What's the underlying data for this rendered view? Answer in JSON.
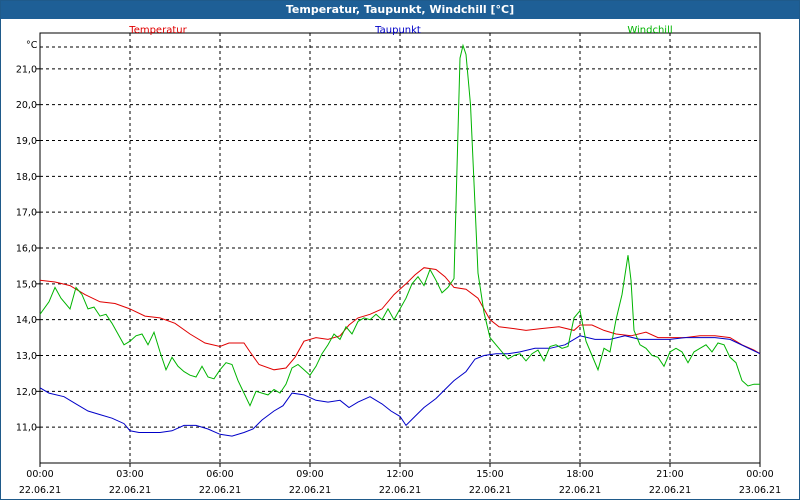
{
  "window": {
    "title": "Temperatur, Taupunkt, Windchill [°C]"
  },
  "chart_data": {
    "type": "line",
    "title": "Temperatur, Taupunkt, Windchill [°C]",
    "ylabel": "°C",
    "ylim": [
      10.0,
      22.0
    ],
    "y_ticks": [
      "11,0",
      "12,0",
      "13,0",
      "14,0",
      "15,0",
      "16,0",
      "17,0",
      "18,0",
      "19,0",
      "20,0",
      "21,0"
    ],
    "y_tick_values": [
      11,
      12,
      13,
      14,
      15,
      16,
      17,
      18,
      19,
      20,
      21
    ],
    "xlim": [
      0,
      24
    ],
    "x_ticks": [
      {
        "time": "00:00",
        "date": "22.06.21",
        "hour": 0
      },
      {
        "time": "03:00",
        "date": "22.06.21",
        "hour": 3
      },
      {
        "time": "06:00",
        "date": "22.06.21",
        "hour": 6
      },
      {
        "time": "09:00",
        "date": "22.06.21",
        "hour": 9
      },
      {
        "time": "12:00",
        "date": "22.06.21",
        "hour": 12
      },
      {
        "time": "15:00",
        "date": "22.06.21",
        "hour": 15
      },
      {
        "time": "18:00",
        "date": "22.06.21",
        "hour": 18
      },
      {
        "time": "21:00",
        "date": "22.06.21",
        "hour": 21
      },
      {
        "time": "00:00",
        "date": "23.06.21",
        "hour": 24
      }
    ],
    "grid": true,
    "legend_position": "top",
    "series": [
      {
        "name": "Temperatur",
        "color": "#e00000",
        "points": [
          [
            0,
            15.1
          ],
          [
            0.5,
            15.05
          ],
          [
            1,
            14.95
          ],
          [
            1.5,
            14.7
          ],
          [
            2,
            14.5
          ],
          [
            2.5,
            14.45
          ],
          [
            3,
            14.3
          ],
          [
            3.5,
            14.1
          ],
          [
            4,
            14.05
          ],
          [
            4.5,
            13.9
          ],
          [
            5,
            13.6
          ],
          [
            5.5,
            13.35
          ],
          [
            6,
            13.25
          ],
          [
            6.3,
            13.35
          ],
          [
            6.8,
            13.35
          ],
          [
            7,
            13.1
          ],
          [
            7.3,
            12.75
          ],
          [
            7.8,
            12.6
          ],
          [
            8.2,
            12.65
          ],
          [
            8.5,
            12.95
          ],
          [
            8.8,
            13.4
          ],
          [
            9.2,
            13.5
          ],
          [
            9.6,
            13.45
          ],
          [
            10,
            13.55
          ],
          [
            10.3,
            13.85
          ],
          [
            10.6,
            14.05
          ],
          [
            11,
            14.15
          ],
          [
            11.4,
            14.3
          ],
          [
            11.8,
            14.7
          ],
          [
            12.2,
            15.0
          ],
          [
            12.5,
            15.25
          ],
          [
            12.8,
            15.45
          ],
          [
            13.2,
            15.4
          ],
          [
            13.5,
            15.2
          ],
          [
            13.8,
            14.9
          ],
          [
            14.2,
            14.85
          ],
          [
            14.6,
            14.6
          ],
          [
            15,
            14.0
          ],
          [
            15.3,
            13.8
          ],
          [
            15.8,
            13.75
          ],
          [
            16.2,
            13.7
          ],
          [
            16.7,
            13.75
          ],
          [
            17.3,
            13.8
          ],
          [
            17.8,
            13.7
          ],
          [
            18,
            13.85
          ],
          [
            18.4,
            13.85
          ],
          [
            18.8,
            13.7
          ],
          [
            19.2,
            13.6
          ],
          [
            19.7,
            13.55
          ],
          [
            20.2,
            13.65
          ],
          [
            20.6,
            13.5
          ],
          [
            21,
            13.5
          ],
          [
            21.5,
            13.5
          ],
          [
            22,
            13.55
          ],
          [
            22.5,
            13.55
          ],
          [
            23,
            13.5
          ],
          [
            23.4,
            13.3
          ],
          [
            23.8,
            13.15
          ],
          [
            24,
            13.05
          ]
        ]
      },
      {
        "name": "Taupunkt",
        "color": "#0000c8",
        "points": [
          [
            0,
            12.1
          ],
          [
            0.3,
            11.95
          ],
          [
            0.8,
            11.85
          ],
          [
            1.2,
            11.65
          ],
          [
            1.6,
            11.45
          ],
          [
            2,
            11.35
          ],
          [
            2.4,
            11.25
          ],
          [
            2.8,
            11.1
          ],
          [
            3,
            10.9
          ],
          [
            3.3,
            10.85
          ],
          [
            3.6,
            10.85
          ],
          [
            4,
            10.85
          ],
          [
            4.4,
            10.9
          ],
          [
            4.8,
            11.05
          ],
          [
            5.2,
            11.05
          ],
          [
            5.6,
            10.95
          ],
          [
            6,
            10.8
          ],
          [
            6.4,
            10.75
          ],
          [
            6.8,
            10.85
          ],
          [
            7.1,
            10.95
          ],
          [
            7.4,
            11.2
          ],
          [
            7.8,
            11.45
          ],
          [
            8.1,
            11.6
          ],
          [
            8.4,
            11.95
          ],
          [
            8.8,
            11.9
          ],
          [
            9.2,
            11.75
          ],
          [
            9.6,
            11.7
          ],
          [
            10,
            11.75
          ],
          [
            10.3,
            11.55
          ],
          [
            10.6,
            11.7
          ],
          [
            11,
            11.85
          ],
          [
            11.4,
            11.65
          ],
          [
            11.7,
            11.45
          ],
          [
            12,
            11.3
          ],
          [
            12.2,
            11.05
          ],
          [
            12.5,
            11.3
          ],
          [
            12.8,
            11.55
          ],
          [
            13.2,
            11.8
          ],
          [
            13.5,
            12.05
          ],
          [
            13.8,
            12.3
          ],
          [
            14.2,
            12.55
          ],
          [
            14.5,
            12.9
          ],
          [
            14.8,
            13.0
          ],
          [
            15.2,
            13.05
          ],
          [
            15.6,
            13.05
          ],
          [
            16,
            13.1
          ],
          [
            16.5,
            13.2
          ],
          [
            17,
            13.2
          ],
          [
            17.5,
            13.3
          ],
          [
            18,
            13.55
          ],
          [
            18.5,
            13.45
          ],
          [
            19,
            13.45
          ],
          [
            19.5,
            13.55
          ],
          [
            20,
            13.45
          ],
          [
            20.5,
            13.45
          ],
          [
            21,
            13.45
          ],
          [
            21.5,
            13.5
          ],
          [
            22,
            13.5
          ],
          [
            22.5,
            13.5
          ],
          [
            23,
            13.45
          ],
          [
            23.5,
            13.25
          ],
          [
            24,
            13.05
          ]
        ]
      },
      {
        "name": "Windchill",
        "color": "#00b400",
        "points": [
          [
            0,
            14.15
          ],
          [
            0.3,
            14.5
          ],
          [
            0.5,
            14.9
          ],
          [
            0.7,
            14.6
          ],
          [
            1,
            14.3
          ],
          [
            1.2,
            14.9
          ],
          [
            1.4,
            14.7
          ],
          [
            1.6,
            14.3
          ],
          [
            1.8,
            14.35
          ],
          [
            2,
            14.1
          ],
          [
            2.2,
            14.15
          ],
          [
            2.4,
            13.9
          ],
          [
            2.6,
            13.6
          ],
          [
            2.8,
            13.3
          ],
          [
            3,
            13.4
          ],
          [
            3.2,
            13.55
          ],
          [
            3.4,
            13.6
          ],
          [
            3.6,
            13.3
          ],
          [
            3.8,
            13.65
          ],
          [
            4,
            13.1
          ],
          [
            4.2,
            12.6
          ],
          [
            4.4,
            12.95
          ],
          [
            4.6,
            12.7
          ],
          [
            4.8,
            12.55
          ],
          [
            5,
            12.45
          ],
          [
            5.2,
            12.4
          ],
          [
            5.4,
            12.7
          ],
          [
            5.6,
            12.4
          ],
          [
            5.8,
            12.35
          ],
          [
            6,
            12.6
          ],
          [
            6.2,
            12.8
          ],
          [
            6.4,
            12.75
          ],
          [
            6.6,
            12.3
          ],
          [
            6.8,
            11.95
          ],
          [
            7,
            11.6
          ],
          [
            7.2,
            12.0
          ],
          [
            7.4,
            11.95
          ],
          [
            7.6,
            11.9
          ],
          [
            7.8,
            12.05
          ],
          [
            8,
            11.95
          ],
          [
            8.2,
            12.2
          ],
          [
            8.4,
            12.65
          ],
          [
            8.6,
            12.75
          ],
          [
            8.8,
            12.6
          ],
          [
            9,
            12.45
          ],
          [
            9.2,
            12.7
          ],
          [
            9.4,
            13.05
          ],
          [
            9.6,
            13.3
          ],
          [
            9.8,
            13.6
          ],
          [
            10,
            13.45
          ],
          [
            10.2,
            13.8
          ],
          [
            10.4,
            13.6
          ],
          [
            10.6,
            13.95
          ],
          [
            10.8,
            14.05
          ],
          [
            11,
            14.0
          ],
          [
            11.2,
            14.15
          ],
          [
            11.4,
            14.0
          ],
          [
            11.6,
            14.3
          ],
          [
            11.8,
            14.0
          ],
          [
            12,
            14.3
          ],
          [
            12.2,
            14.6
          ],
          [
            12.4,
            15.0
          ],
          [
            12.6,
            15.2
          ],
          [
            12.8,
            14.95
          ],
          [
            13,
            15.4
          ],
          [
            13.2,
            15.1
          ],
          [
            13.4,
            14.75
          ],
          [
            13.6,
            14.9
          ],
          [
            13.8,
            15.15
          ],
          [
            14,
            21.3
          ],
          [
            14.1,
            21.65
          ],
          [
            14.2,
            21.4
          ],
          [
            14.35,
            20.0
          ],
          [
            14.5,
            17.2
          ],
          [
            14.6,
            15.3
          ],
          [
            14.8,
            14.2
          ],
          [
            15,
            13.5
          ],
          [
            15.2,
            13.3
          ],
          [
            15.4,
            13.1
          ],
          [
            15.6,
            12.9
          ],
          [
            15.8,
            13.0
          ],
          [
            16,
            13.05
          ],
          [
            16.2,
            12.85
          ],
          [
            16.4,
            13.05
          ],
          [
            16.6,
            13.15
          ],
          [
            16.8,
            12.85
          ],
          [
            17,
            13.25
          ],
          [
            17.2,
            13.3
          ],
          [
            17.4,
            13.2
          ],
          [
            17.6,
            13.25
          ],
          [
            17.8,
            14.05
          ],
          [
            18,
            14.25
          ],
          [
            18.2,
            13.4
          ],
          [
            18.4,
            13.0
          ],
          [
            18.6,
            12.6
          ],
          [
            18.8,
            13.2
          ],
          [
            19,
            13.1
          ],
          [
            19.2,
            14.0
          ],
          [
            19.4,
            14.7
          ],
          [
            19.6,
            15.8
          ],
          [
            19.7,
            15.1
          ],
          [
            19.8,
            13.7
          ],
          [
            20,
            13.3
          ],
          [
            20.2,
            13.2
          ],
          [
            20.4,
            13.0
          ],
          [
            20.6,
            12.95
          ],
          [
            20.8,
            12.7
          ],
          [
            21,
            13.1
          ],
          [
            21.2,
            13.2
          ],
          [
            21.4,
            13.1
          ],
          [
            21.6,
            12.8
          ],
          [
            21.8,
            13.1
          ],
          [
            22,
            13.2
          ],
          [
            22.2,
            13.3
          ],
          [
            22.4,
            13.1
          ],
          [
            22.6,
            13.35
          ],
          [
            22.8,
            13.3
          ],
          [
            23,
            12.95
          ],
          [
            23.2,
            12.8
          ],
          [
            23.4,
            12.3
          ],
          [
            23.6,
            12.15
          ],
          [
            23.8,
            12.2
          ],
          [
            24,
            12.2
          ]
        ]
      }
    ]
  }
}
